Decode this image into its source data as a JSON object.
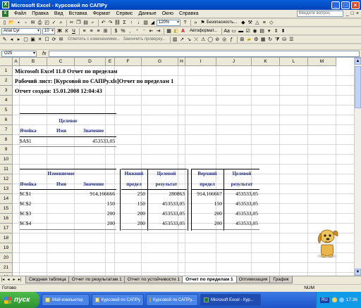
{
  "window": {
    "title": "Microsoft Excel - Курсовой по САПРу"
  },
  "menu": {
    "items": [
      "Файл",
      "Правка",
      "Вид",
      "Вставка",
      "Формат",
      "Сервис",
      "Данные",
      "Окно",
      "Справка"
    ],
    "help_placeholder": "Введите вопрос"
  },
  "toolbar": {
    "zoom": "120%",
    "font_name": "Arial Cyr",
    "font_size": "10",
    "security_label": "Безопасность...",
    "autoformat_label": "Автоформат...",
    "reply_label": "Ответить с изменениями...",
    "end_review_label": "Закончить проверку..."
  },
  "formula": {
    "name_box": "O25",
    "fx": "fx",
    "value": ""
  },
  "columns": [
    "A",
    "B",
    "C",
    "D",
    "E",
    "F",
    "G",
    "H",
    "I",
    "J",
    "K",
    "L",
    "M"
  ],
  "rows": [
    "1",
    "2",
    "3",
    "4",
    "5",
    "6",
    "7",
    "8",
    "9",
    "10",
    "11",
    "12",
    "13",
    "14",
    "15",
    "16",
    "17",
    "18",
    "19",
    "20",
    "21",
    "22",
    "23",
    "24"
  ],
  "report": {
    "title": "Microsoft Excel 11.0 Отчет по пределам",
    "sheet": "Рабочий лист: [Курсовой по САПРу.xls]Отчет по пределам 1",
    "created": "Отчет создан: 15.01.2008 12:04:43",
    "target": {
      "header": "Целевое",
      "col_cell": "Ячейка",
      "col_name": "Имя",
      "col_value": "Значение",
      "cell": "$A$1",
      "name": "",
      "value": "453533,05"
    },
    "variable": {
      "header": "Изменяемое",
      "col_cell": "Ячейка",
      "col_name": "Имя",
      "col_value": "Значение",
      "lower_h1": "Нижний",
      "lower_h2": "предел",
      "lower_res_h1": "Целевой",
      "lower_res_h2": "результат",
      "upper_h1": "Верхний",
      "upper_h2": "предел",
      "upper_res_h1": "Целевой",
      "upper_res_h2": "результат",
      "rows": [
        {
          "cell": "$C$1",
          "name": "",
          "value": "914,166666",
          "lower": "250",
          "lower_res": "280863",
          "upper": "914,166667",
          "upper_res": "453533,05"
        },
        {
          "cell": "$C$2",
          "name": "",
          "value": "150",
          "lower": "150",
          "lower_res": "453533,05",
          "upper": "150",
          "upper_res": "453533,05"
        },
        {
          "cell": "$C$3",
          "name": "",
          "value": "200",
          "lower": "200",
          "lower_res": "453533,05",
          "upper": "200",
          "upper_res": "453533,05"
        },
        {
          "cell": "$C$4",
          "name": "",
          "value": "200",
          "lower": "200",
          "lower_res": "453533,05",
          "upper": "200",
          "upper_res": "453533,05"
        }
      ]
    }
  },
  "tabs": [
    "Сводная таблица",
    "Отчет по результатам 1",
    "Отчет по устойчивости 1",
    "Отчет по пределам 1",
    "Оптимизация",
    "График"
  ],
  "active_tab_index": 3,
  "status": {
    "left": "Готово",
    "num": "NUM"
  },
  "taskbar": {
    "start": "пуск",
    "buttons": [
      "Мой компьютер",
      "Курсовой по САПРу",
      "Курсовой по САПРу...",
      "Microsoft Excel - Кур..."
    ],
    "lang": "RU",
    "clock": "17:36"
  }
}
